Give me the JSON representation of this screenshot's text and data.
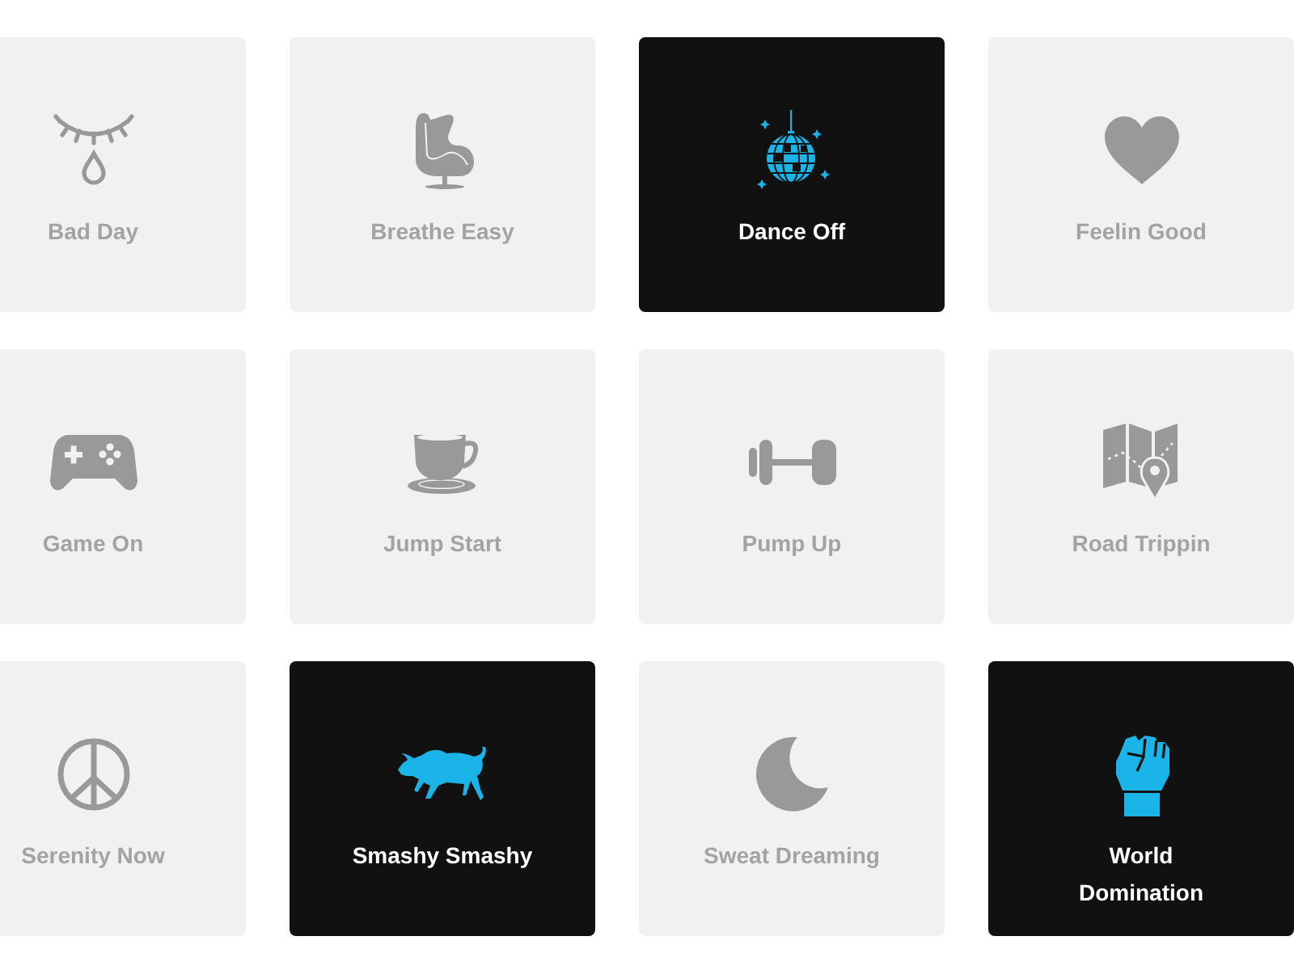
{
  "tiles": [
    {
      "label": "Bad Day",
      "selected": false
    },
    {
      "label": "Breathe Easy",
      "selected": false
    },
    {
      "label": "Dance Off",
      "selected": true
    },
    {
      "label": "Feelin Good",
      "selected": false
    },
    {
      "label": "Game On",
      "selected": false
    },
    {
      "label": "Jump Start",
      "selected": false
    },
    {
      "label": "Pump Up",
      "selected": false
    },
    {
      "label": "Road Trippin",
      "selected": false
    },
    {
      "label": "Serenity Now",
      "selected": false
    },
    {
      "label": "Smashy Smashy",
      "selected": true
    },
    {
      "label": "Sweat Dreaming",
      "selected": false
    },
    {
      "label": "World Domination",
      "selected": true
    }
  ]
}
